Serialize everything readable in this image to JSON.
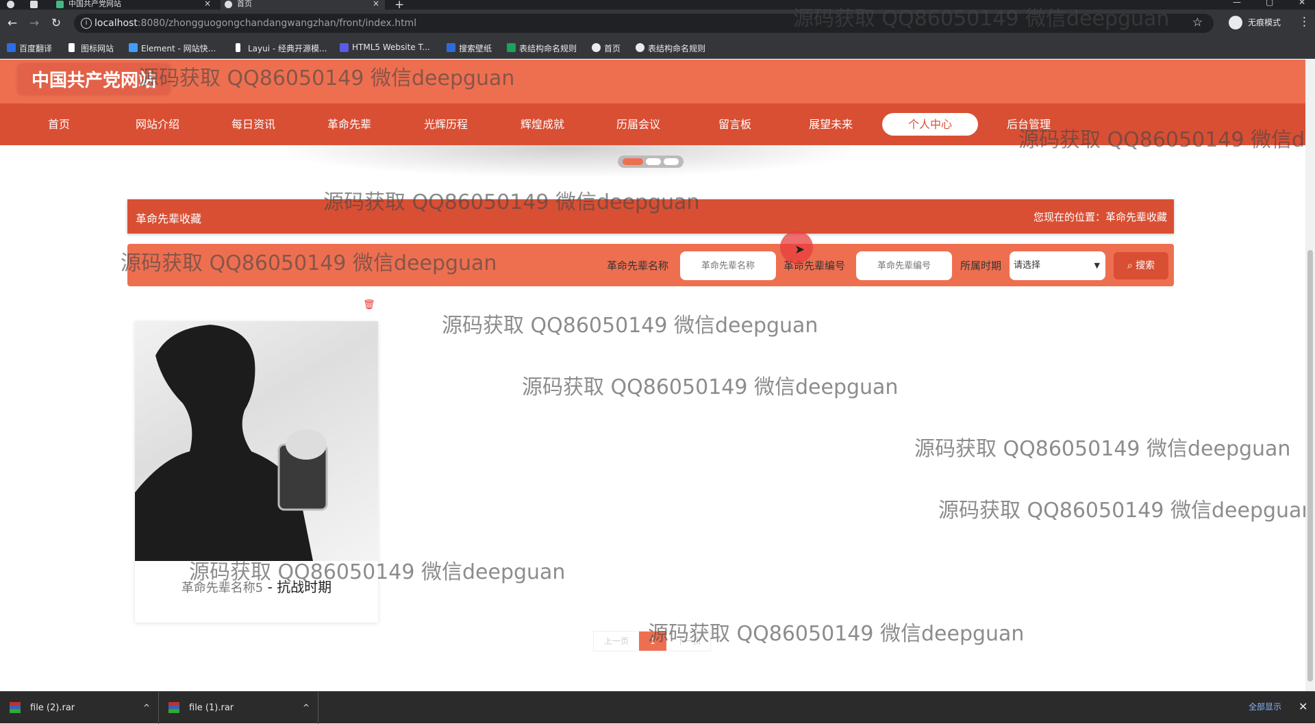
{
  "browser": {
    "tabs": [
      {
        "title": "中国共产党网站",
        "active": false
      },
      {
        "title": "首页",
        "active": true
      }
    ],
    "new_tab_label": "+",
    "url_host": "localhost",
    "url_path": ":8080/zhongguogongchandangwangzhan/front/index.html",
    "incognito_label": "无痕模式",
    "bookmarks": [
      {
        "label": "百度翻译",
        "color": "#2b6de5"
      },
      {
        "label": "图标网站",
        "color": "#ffffff"
      },
      {
        "label": "Element - 网站快...",
        "color": "#409eff"
      },
      {
        "label": "Layui - 经典开源模...",
        "color": "#ffffff"
      },
      {
        "label": "HTML5 Website T...",
        "color": "#5b5be6"
      },
      {
        "label": "搜索壁纸",
        "color": "#2f6ad9"
      },
      {
        "label": "表结构命名规则",
        "color": "#1aa260"
      },
      {
        "label": "首页",
        "color": "#e8eaed"
      },
      {
        "label": "表结构命名规则",
        "color": "#e8eaed"
      }
    ]
  },
  "site": {
    "logo": "中国共产党网站",
    "nav": [
      "首页",
      "网站介绍",
      "每日资讯",
      "革命先辈",
      "光辉历程",
      "辉煌成就",
      "历届会议",
      "留言板",
      "展望未来",
      "个人中心",
      "后台管理"
    ],
    "active_nav": "个人中心",
    "accent": "#ee6f50",
    "accent_dark": "#d94f34"
  },
  "section": {
    "title": "革命先辈收藏",
    "location": "您现在的位置：革命先辈收藏"
  },
  "search": {
    "name_label": "革命先辈名称",
    "name_placeholder": "革命先辈名称",
    "code_label": "革命先辈编号",
    "code_placeholder": "革命先辈编号",
    "period_label": "所属时期",
    "period_value": "请选择",
    "button_label": "搜索"
  },
  "cards": [
    {
      "name": "革命先辈名称5",
      "separator": " - ",
      "period": "抗战时期"
    }
  ],
  "pagination": {
    "prev": "上一页",
    "current": "1",
    "next": "下一页"
  },
  "watermark_text": "源码获取 QQ86050149 微信deepguan",
  "downloads": [
    {
      "name": "file (2).rar"
    },
    {
      "name": "file (1).rar"
    }
  ],
  "downloads_show_all": "全部显示"
}
